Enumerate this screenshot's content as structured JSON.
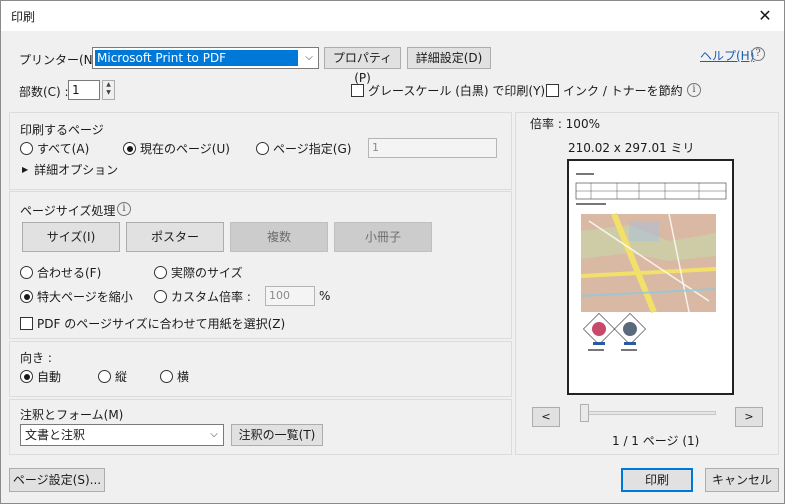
{
  "window": {
    "title": "印刷",
    "close_label": "✕"
  },
  "printer": {
    "label": "プリンター(N) :",
    "selected": "Microsoft Print to PDF",
    "properties_button": "プロパティ(P)",
    "advanced_button": "詳細設定(D)",
    "help_link": "ヘルプ(H)",
    "help_icon": "?"
  },
  "copies": {
    "label": "部数(C) :",
    "value": "1"
  },
  "options": {
    "grayscale": "グレースケール (白黒) で印刷(Y)",
    "save_ink": "インク / トナーを節約"
  },
  "pages_section": {
    "title": "印刷するページ",
    "all": "すべて(A)",
    "current": "現在のページ(U)",
    "specified": "ページ指定(G)",
    "range_value": "1",
    "more_options": "詳細オプション",
    "selected": "current"
  },
  "size_section": {
    "title": "ページサイズ処理",
    "tabs": [
      "サイズ(I)",
      "ポスター",
      "複数",
      "小冊子"
    ],
    "fit": "合わせる(F)",
    "actual": "実際のサイズ",
    "shrink": "特大ページを縮小",
    "custom": "カスタム倍率 :",
    "custom_value": "100",
    "percent": "%",
    "choose_paper": "PDF のページサイズに合わせて用紙を選択(Z)",
    "selected": "shrink"
  },
  "orientation": {
    "title": "向き :",
    "auto": "自動",
    "portrait": "縦",
    "landscape": "横",
    "selected": "auto"
  },
  "annotations": {
    "title": "注釈とフォーム(M)",
    "selected": "文書と注釈",
    "summary_button": "注釈の一覧(T)"
  },
  "preview": {
    "scale": "倍率 : 100%",
    "dimensions": "210.02 x 297.01 ミリ",
    "page_indicator": "1 / 1 ページ (1)",
    "prev": "<",
    "next": ">"
  },
  "footer": {
    "page_setup": "ページ設定(S)...",
    "print": "印刷",
    "cancel": "キャンセル"
  },
  "colors": {
    "accent": "#0078d7",
    "link": "#1a5fb4"
  }
}
